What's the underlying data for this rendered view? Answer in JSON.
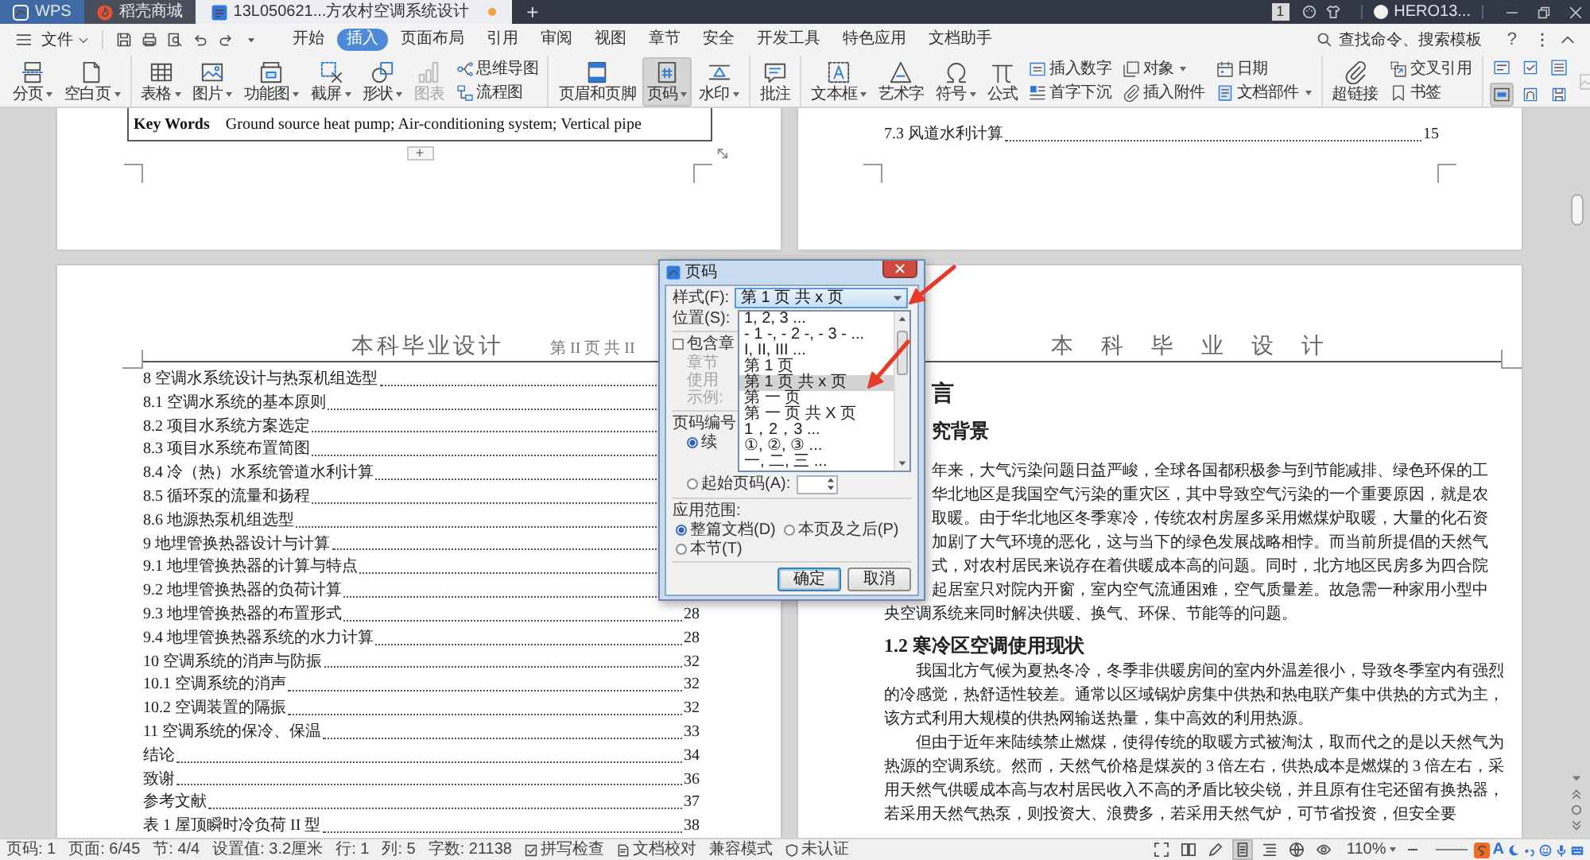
{
  "title_bar": {
    "tabs": [
      {
        "kind": "app",
        "label": "WPS",
        "selected": false,
        "modified": false
      },
      {
        "kind": "store",
        "label": "稻壳商城",
        "selected": false,
        "modified": false
      },
      {
        "kind": "document",
        "label": "13L050621...方农村空调系统设计",
        "selected": true,
        "modified": true
      }
    ],
    "new_tab": "+",
    "notice_count": "1",
    "user": "HERO13..."
  },
  "menu_bar": {
    "file": "文件",
    "tabs": [
      {
        "label": "开始",
        "selected": false
      },
      {
        "label": "插入",
        "selected": true
      },
      {
        "label": "页面布局",
        "selected": false
      },
      {
        "label": "引用",
        "selected": false
      },
      {
        "label": "审阅",
        "selected": false
      },
      {
        "label": "视图",
        "selected": false
      },
      {
        "label": "章节",
        "selected": false
      },
      {
        "label": "安全",
        "selected": false
      },
      {
        "label": "开发工具",
        "selected": false
      },
      {
        "label": "特色应用",
        "selected": false
      },
      {
        "label": "文档助手",
        "selected": false
      }
    ],
    "search": {
      "placeholder": "查找命令、搜索模板"
    },
    "help": "?"
  },
  "ribbon": {
    "groups": [
      {
        "items": [
          {
            "kind": "large",
            "label": "分页",
            "dropdown": true,
            "active": false,
            "disabled": false
          },
          {
            "kind": "large",
            "label": "空白页",
            "dropdown": true,
            "active": false,
            "disabled": false
          }
        ]
      },
      {
        "items": [
          {
            "kind": "large",
            "label": "表格",
            "dropdown": true,
            "active": false,
            "disabled": false
          },
          {
            "kind": "large",
            "label": "图片",
            "dropdown": true,
            "active": false,
            "disabled": false
          },
          {
            "kind": "large",
            "label": "功能图",
            "dropdown": true,
            "active": false,
            "disabled": false
          },
          {
            "kind": "large",
            "label": "截屏",
            "dropdown": true,
            "active": false,
            "disabled": false
          },
          {
            "kind": "large",
            "label": "形状",
            "dropdown": true,
            "active": false,
            "disabled": false
          },
          {
            "kind": "large",
            "label": "图表",
            "dropdown": false,
            "active": false,
            "disabled": true
          },
          {
            "kind": "small",
            "label": "思维导图",
            "dropdown": false,
            "active": false,
            "disabled": false
          },
          {
            "kind": "small",
            "label": "流程图",
            "dropdown": false,
            "active": false,
            "disabled": false
          }
        ]
      },
      {
        "items": [
          {
            "kind": "large",
            "label": "页眉和页脚",
            "dropdown": false,
            "active": false,
            "disabled": false
          },
          {
            "kind": "large",
            "label": "页码",
            "dropdown": true,
            "active": true,
            "disabled": false
          },
          {
            "kind": "large",
            "label": "水印",
            "dropdown": true,
            "active": false,
            "disabled": false
          }
        ]
      },
      {
        "items": [
          {
            "kind": "large",
            "label": "批注",
            "dropdown": false,
            "active": false,
            "disabled": false
          }
        ]
      },
      {
        "items": [
          {
            "kind": "large",
            "label": "文本框",
            "dropdown": true,
            "active": false,
            "disabled": false
          },
          {
            "kind": "large",
            "label": "艺术字",
            "dropdown": false,
            "active": false,
            "disabled": false
          },
          {
            "kind": "large",
            "label": "符号",
            "dropdown": true,
            "active": false,
            "disabled": false
          },
          {
            "kind": "large",
            "label": "公式",
            "dropdown": false,
            "active": false,
            "disabled": false
          },
          {
            "kind": "small",
            "label": "插入数字",
            "dropdown": false,
            "active": false,
            "disabled": false
          },
          {
            "kind": "small",
            "label": "首字下沉",
            "dropdown": false,
            "active": false,
            "disabled": false
          },
          {
            "kind": "small",
            "label": "对象",
            "dropdown": true,
            "active": false,
            "disabled": false
          },
          {
            "kind": "small",
            "label": "插入附件",
            "dropdown": false,
            "active": false,
            "disabled": false
          },
          {
            "kind": "small",
            "label": "日期",
            "dropdown": false,
            "active": false,
            "disabled": false
          },
          {
            "kind": "small",
            "label": "文档部件",
            "dropdown": true,
            "active": false,
            "disabled": false
          }
        ]
      },
      {
        "items": [
          {
            "kind": "large",
            "label": "超链接",
            "dropdown": false,
            "active": false,
            "disabled": false
          },
          {
            "kind": "small",
            "label": "交叉引用",
            "dropdown": false,
            "active": false,
            "disabled": false
          },
          {
            "kind": "small",
            "label": "书签",
            "dropdown": false,
            "active": false,
            "disabled": false
          }
        ]
      },
      {
        "items": [
          {
            "kind": "icon",
            "active": false,
            "disabled": false
          },
          {
            "kind": "icon",
            "active": true,
            "disabled": false
          },
          {
            "kind": "icon",
            "active": false,
            "disabled": false
          },
          {
            "kind": "icon",
            "active": false,
            "disabled": false
          },
          {
            "kind": "icon",
            "active": false,
            "disabled": false
          },
          {
            "kind": "icon",
            "active": false,
            "disabled": false
          },
          {
            "kind": "icon",
            "active": false,
            "disabled": true
          }
        ]
      }
    ]
  },
  "document": {
    "left": {
      "upper": {
        "keywords": {
          "label": "Key Words",
          "text": "Ground source heat pump; Air-conditioning system; Vertical pipe"
        },
        "add_button": "+"
      },
      "lower": {
        "header_title": "本科毕业设计",
        "header_page": "第 II 页 共 II",
        "toc": [
          {
            "title": "8 空调水系统设计与热泵机组选型"
          },
          {
            "title": "8.1 空调水系统的基本原则"
          },
          {
            "title": "8.2 项目水系统方案选定"
          },
          {
            "title": "8.3 项目水系统布置简图"
          },
          {
            "title": "8.4 冷（热）水系统管道水利计算"
          },
          {
            "title": "8.5 循环泵的流量和扬程"
          },
          {
            "title": "8.6 地源热泵机组选型"
          },
          {
            "title": "9 地埋管换热器设计与计算"
          },
          {
            "title": "9.1 地埋管换热器的计算与特点"
          },
          {
            "title": "9.2 地埋管换热器的负荷计算"
          },
          {
            "title": "9.3 地埋管换热器的布置形式",
            "page": "28"
          },
          {
            "title": "9.4 地埋管换热器系统的水力计算",
            "page": "28"
          },
          {
            "title": "10 空调系统的消声与防振",
            "page": "32"
          },
          {
            "title": "10.1 空调系统的消声",
            "page": "32"
          },
          {
            "title": "10.2 空调装置的隔振",
            "page": "32"
          },
          {
            "title": "11 空调系统的保冷、保温",
            "page": "33"
          },
          {
            "title": "结论",
            "page": "34"
          },
          {
            "title": "致谢",
            "page": "36"
          },
          {
            "title": "参考文献",
            "page": "37"
          },
          {
            "title": "表 1 屋顶瞬时冷负荷 II 型",
            "page": "38"
          }
        ]
      }
    },
    "right": {
      "upper": {
        "toc": [
          {
            "title": "7.3 风道水利计算",
            "page": "15"
          }
        ]
      },
      "lower": {
        "header_title": "本 科 毕 业 设 计",
        "blocks": [
          {
            "kind": "chapter_heading_part",
            "text": "言"
          },
          {
            "kind": "section_heading_part",
            "text": "究背景"
          },
          {
            "kind": "line_part",
            "text": "年来，大气污染问题日益严峻，全球各国都积极参与到节能减排、绿色环保的工"
          },
          {
            "kind": "line_part",
            "text": "华北地区是我国空气污染的重灾区，其中导致空气污染的一个重要原因，就是农"
          },
          {
            "kind": "line_part",
            "text": "取暖。由于华北地区冬季寒冷，传统农村房屋多采用燃煤炉取暖，大量的化石资"
          },
          {
            "kind": "line_part",
            "text": "加剧了大气环境的恶化，这与当下的绿色发展战略相悖。而当前所提倡的天然气"
          },
          {
            "kind": "line_part",
            "text": "式，对农村居民来说存在着供暖成本高的问题。同时，北方地区民房多为四合院"
          },
          {
            "kind": "line_part",
            "text": "起居室只对院内开窗，室内空气流通困难，空气质量差。故急需一种家用小型中"
          },
          {
            "kind": "line",
            "text": "央空调系统来同时解决供暖、换气、环保、节能等的问题。"
          },
          {
            "kind": "section_heading",
            "text": "1.2 寒冷区空调使用现状"
          },
          {
            "kind": "paragraph",
            "text": "我国北方气候为夏热冬冷，冬季非供暖房间的室内外温差很小，导致冬季室内有强烈的冷感觉，热舒适性较差。通常以区域锅炉房集中供热和热电联产集中供热的方式为主，该方式利用大规模的供热网输送热量，集中高效的利用热源。"
          },
          {
            "kind": "paragraph",
            "text": "但由于近年来陆续禁止燃煤，使得传统的取暖方式被淘汰，取而代之的是以天然气为热源的空调系统。然而，天然气价格是煤炭的 3 倍左右，供热成本是燃煤的 3 倍左右，采用天然气供暖成本高与农村居民收入不高的矛盾比较尖锐，并且原有住宅还留有换热器，若采用天然气热泵，则投资大、浪费多，若采用天然气炉，可节省投资，但安全要"
          }
        ]
      }
    }
  },
  "dialog": {
    "title": "页码",
    "style": {
      "label": "样式(F):",
      "value": "第 1 页 共 x 页",
      "options": [
        {
          "label": "1, 2, 3 ...",
          "selected": false
        },
        {
          "label": "- 1 -, - 2 -, - 3 - ...",
          "selected": false
        },
        {
          "label": "I, II, III ...",
          "selected": false
        },
        {
          "label": "第 1 页",
          "selected": false
        },
        {
          "label": "第 1 页 共 x 页",
          "selected": true
        },
        {
          "label": "第 一 页",
          "selected": false
        },
        {
          "label": "第 一 页 共 X 页",
          "selected": false
        },
        {
          "label": "1，2，3 ...",
          "selected": false
        },
        {
          "label": "①, ②, ③ ...",
          "selected": false
        },
        {
          "label": "一, 二, 三 ...",
          "selected": false
        }
      ]
    },
    "position": {
      "label": "位置(S):"
    },
    "include_chapter": {
      "label": "包含章",
      "checked": false
    },
    "chapter_fields": [
      {
        "label": "章节",
        "disabled": true
      },
      {
        "label": "使用",
        "disabled": true
      },
      {
        "label": "示例:",
        "disabled": true
      }
    ],
    "numbering": {
      "label": "页码编号",
      "options": [
        {
          "label": "续",
          "selected": true
        },
        {
          "label": "起始页码(A):",
          "selected": false
        }
      ]
    },
    "scope": {
      "label": "应用范围:",
      "options": [
        {
          "label": "整篇文档(D)",
          "selected": true
        },
        {
          "label": "本页及之后(P)",
          "selected": false
        },
        {
          "label": "本节(T)",
          "selected": false
        }
      ]
    },
    "buttons": [
      {
        "label": "确定",
        "default": true
      },
      {
        "label": "取消",
        "default": false
      }
    ]
  },
  "annotations": [
    {
      "kind": "arrow"
    },
    {
      "kind": "arrow"
    }
  ],
  "status_bar": {
    "items": [
      {
        "kind": "text",
        "label": "页码: 1"
      },
      {
        "kind": "text",
        "label": "页面: 6/45"
      },
      {
        "kind": "text",
        "label": "节: 4/4"
      },
      {
        "kind": "text",
        "label": "设置值: 3.2厘米"
      },
      {
        "kind": "text",
        "label": "行: 1"
      },
      {
        "kind": "text",
        "label": "列: 5"
      },
      {
        "kind": "text",
        "label": "字数: 21138"
      },
      {
        "kind": "button",
        "label": "拼写检查"
      },
      {
        "kind": "button",
        "label": "文档校对"
      },
      {
        "kind": "text",
        "label": "兼容模式"
      },
      {
        "kind": "button",
        "label": "未认证"
      }
    ],
    "views": [
      {
        "selected": false
      },
      {
        "selected": false
      },
      {
        "selected": false
      },
      {
        "selected": true
      },
      {
        "selected": false
      },
      {
        "selected": false
      },
      {
        "selected": false
      }
    ],
    "zoom": "110%",
    "ime_mode": "A"
  }
}
